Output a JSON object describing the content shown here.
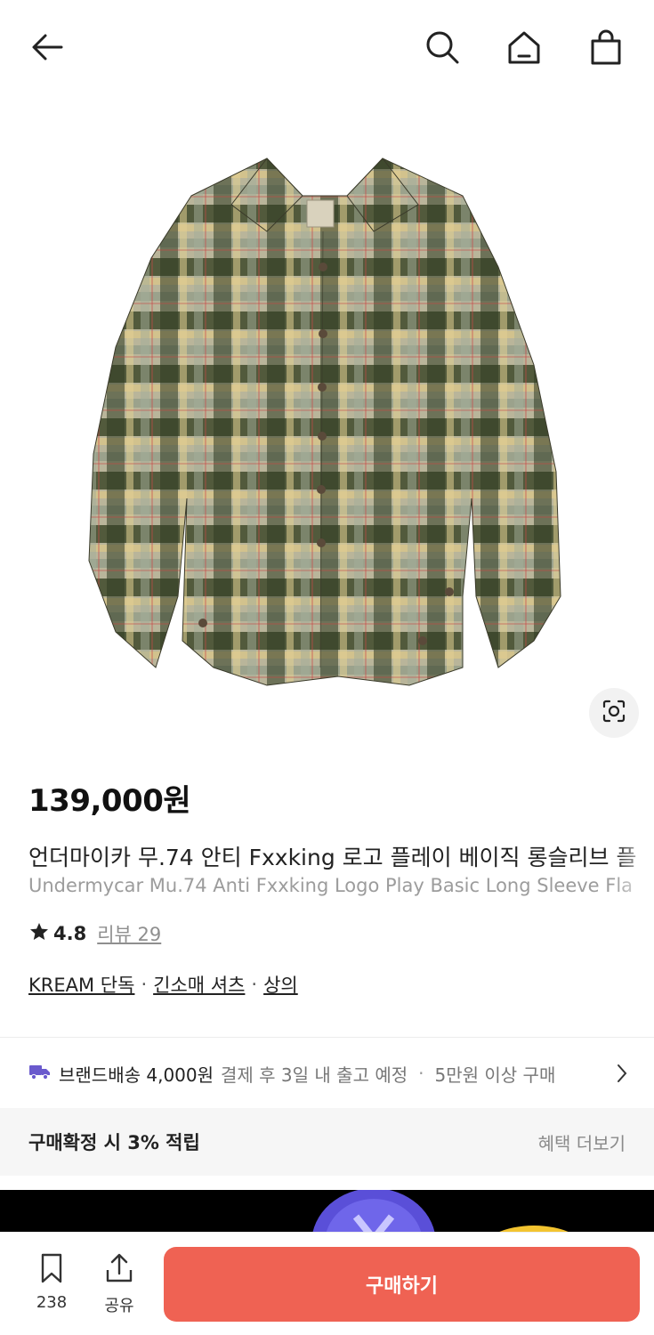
{
  "header": {
    "icons": [
      "back-arrow-icon",
      "search-icon",
      "home-icon",
      "shopping-bag-icon"
    ]
  },
  "product": {
    "image": "plaid-flannel-shirt",
    "price": "139,000원",
    "title_ko": "언더마이카 무.74 안티 Fxxking 로고 플레이 베이직 롱슬리브 플",
    "title_en": "Undermycar Mu.74 Anti Fxxking Logo Play Basic Long Sleeve Fla",
    "rating": "4.8",
    "review_label": "리뷰 29",
    "categories": [
      "KREAM 단독",
      "긴소매 셔츠",
      "상의"
    ]
  },
  "delivery": {
    "main": "브랜드배송 4,000원",
    "sub": "결제 후 3일 내 출고 예정",
    "separator": "·",
    "extra": "5만원 이상 구매",
    "icon": "truck-icon",
    "icon_color": "#6a5acd"
  },
  "benefit": {
    "label": "구매확정 시 3% 적립",
    "more": "혜택 더보기"
  },
  "bottom": {
    "bookmark_count": "238",
    "share_label": "공유",
    "buy_label": "구매하기",
    "buy_color": "#ef6253"
  }
}
